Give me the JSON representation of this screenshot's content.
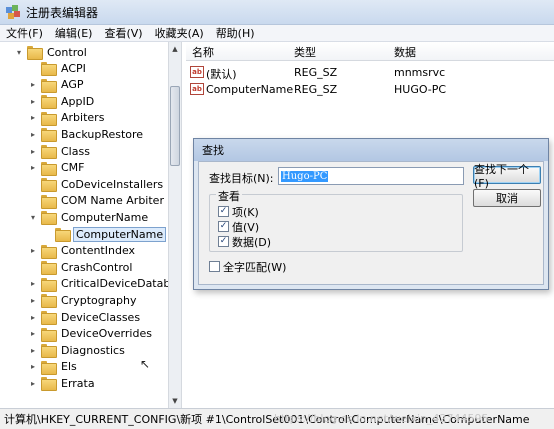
{
  "window": {
    "title": "注册表编辑器"
  },
  "menu": [
    "文件(F)",
    "编辑(E)",
    "查看(V)",
    "收藏夹(A)",
    "帮助(H)"
  ],
  "tree": {
    "root": {
      "label": "Control",
      "toggle": "▾"
    },
    "items": [
      {
        "label": "ACPI",
        "toggle": ""
      },
      {
        "label": "AGP",
        "toggle": "▸"
      },
      {
        "label": "AppID",
        "toggle": "▸"
      },
      {
        "label": "Arbiters",
        "toggle": "▸"
      },
      {
        "label": "BackupRestore",
        "toggle": "▸"
      },
      {
        "label": "Class",
        "toggle": "▸"
      },
      {
        "label": "CMF",
        "toggle": "▸"
      },
      {
        "label": "CoDeviceInstallers",
        "toggle": ""
      },
      {
        "label": "COM Name Arbiter",
        "toggle": ""
      },
      {
        "label": "ComputerName",
        "toggle": "▾"
      },
      {
        "label": "ComputerName",
        "toggle": "",
        "selected": true
      },
      {
        "label": "ContentIndex",
        "toggle": "▸"
      },
      {
        "label": "CrashControl",
        "toggle": ""
      },
      {
        "label": "CriticalDeviceDatabase",
        "toggle": "▸"
      },
      {
        "label": "Cryptography",
        "toggle": "▸"
      },
      {
        "label": "DeviceClasses",
        "toggle": "▸"
      },
      {
        "label": "DeviceOverrides",
        "toggle": "▸"
      },
      {
        "label": "Diagnostics",
        "toggle": "▸"
      },
      {
        "label": "Els",
        "toggle": "▸"
      },
      {
        "label": "Errata",
        "toggle": "▸"
      }
    ]
  },
  "list": {
    "columns": [
      "名称",
      "类型",
      "数据"
    ],
    "rows": [
      {
        "icon": "ab",
        "name": "(默认)",
        "type": "REG_SZ",
        "data": "mnmsrvc"
      },
      {
        "icon": "ab",
        "name": "ComputerName",
        "type": "REG_SZ",
        "data": "HUGO-PC"
      }
    ]
  },
  "dialog": {
    "title": "查找",
    "find_label": "查找目标(N):",
    "find_value": "Hugo-PC",
    "find_next_button": "查找下一个(F)",
    "cancel_button": "取消",
    "look_at_title": "查看",
    "options": [
      {
        "label": "项(K)",
        "checked": true
      },
      {
        "label": "值(V)",
        "checked": true
      },
      {
        "label": "数据(D)",
        "checked": true
      }
    ],
    "match_whole": {
      "label": "全字匹配(W)",
      "checked": false
    }
  },
  "statusbar": {
    "path": "计算机\\HKEY_CURRENT_CONFIG\\新项 #1\\ControlSet001\\Control\\ComputerName\\ComputerName"
  },
  "watermark": "https://blog.csdn.net/weixin_42744595"
}
